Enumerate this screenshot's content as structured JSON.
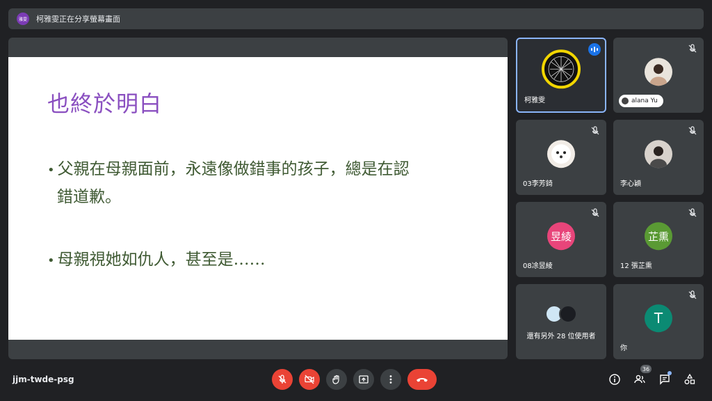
{
  "banner": {
    "avatar_text": "雅雯",
    "text": "柯雅雯正在分享螢幕畫面"
  },
  "slide": {
    "title": "也終於明白",
    "bullets": [
      {
        "line1": "父親在母親面前，永遠像做錯事的孩子，總是在認",
        "line2": "錯道歉。"
      },
      {
        "line1": "母親視她如仇人，甚至是……"
      }
    ]
  },
  "participants": {
    "speaker": {
      "name": "柯雅雯"
    },
    "alana": {
      "name": "alana Yu"
    },
    "p3": {
      "name": "03李芳錡"
    },
    "p4": {
      "name": "李心穎"
    },
    "p5": {
      "name": "08凃昱綾",
      "initials": "昱綾",
      "color": "#e8457a"
    },
    "p6": {
      "name": "12 張芷熏",
      "initials": "芷熏",
      "color": "#5a9a34"
    },
    "others": {
      "text": "還有另外 28 位使用者"
    },
    "self": {
      "name": "你",
      "initials": "T",
      "color": "#0b8a73"
    }
  },
  "footer": {
    "room_code": "jjm-twde-psg",
    "people_count": "36"
  },
  "colors": {
    "end_call": "#ea4335",
    "speaking_border": "#8ab4f8"
  },
  "icons": [
    "mic-off-icon",
    "camera-off-icon",
    "raise-hand-icon",
    "present-icon",
    "more-options-icon",
    "end-call-icon",
    "info-icon",
    "people-icon",
    "chat-icon",
    "activities-icon"
  ]
}
